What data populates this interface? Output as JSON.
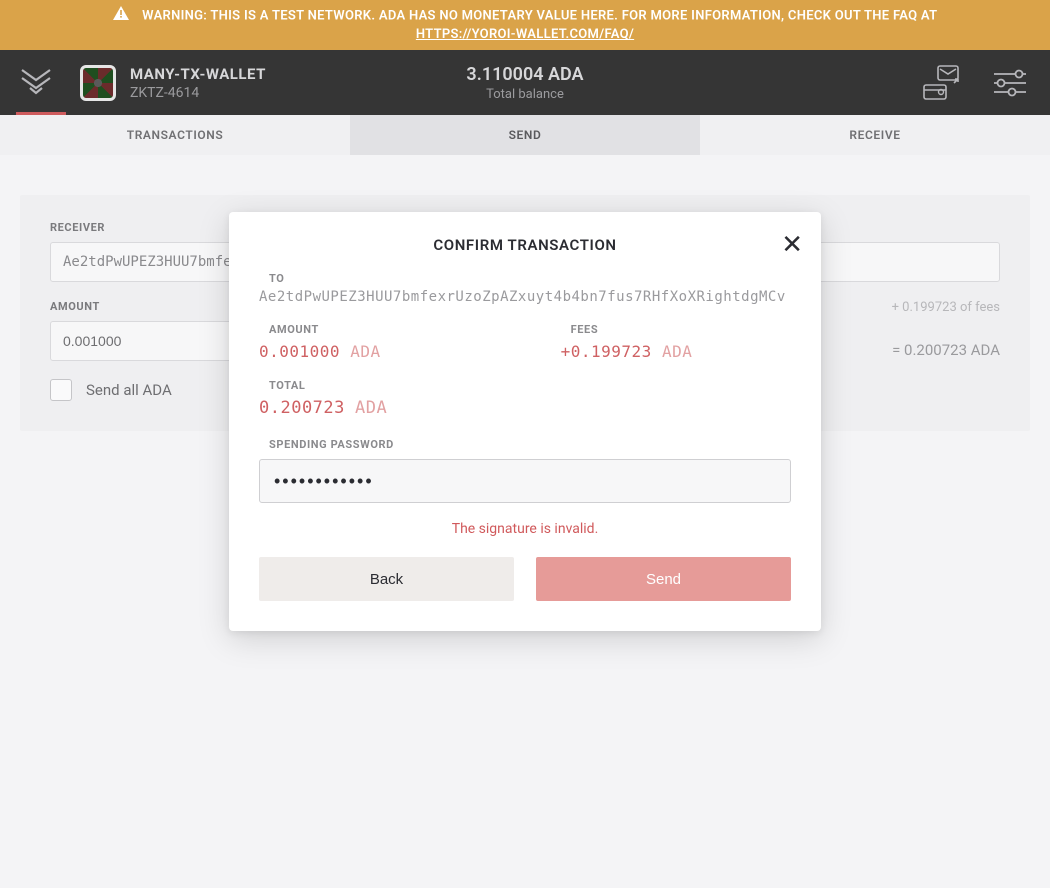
{
  "warning": {
    "prefix": "WARNING: THIS IS A TEST NETWORK. ADA HAS NO MONETARY VALUE HERE. FOR MORE INFORMATION, CHECK OUT THE FAQ AT",
    "link_text": "HTTPS://YOROI-WALLET.COM/FAQ/"
  },
  "header": {
    "wallet_name": "MANY-TX-WALLET",
    "wallet_sub": "ZKTZ-4614",
    "balance_amount": "3.110004 ADA",
    "balance_label": "Total balance"
  },
  "tabs": {
    "transactions": "TRANSACTIONS",
    "send": "SEND",
    "receive": "RECEIVE"
  },
  "send_form": {
    "receiver_label": "RECEIVER",
    "receiver_value": "Ae2tdPwUPEZ3HUU7bmfe",
    "amount_label": "AMOUNT",
    "amount_value": "0.001000",
    "fees_text": "+ 0.199723 of fees",
    "total_text": "= 0.200723 ADA",
    "send_all": "Send all ADA"
  },
  "modal": {
    "title": "CONFIRM TRANSACTION",
    "to_label": "TO",
    "to_value": "Ae2tdPwUPEZ3HUU7bmfexrUzoZpAZxuyt4b4bn7fus7RHfXoXRightdgMCv",
    "amount_label": "AMOUNT",
    "amount_num": "0.001000",
    "amount_cur": "ADA",
    "fees_label": "FEES",
    "fees_num": "+0.199723",
    "fees_cur": "ADA",
    "total_label": "TOTAL",
    "total_num": "0.200723",
    "total_cur": "ADA",
    "pwd_label": "SPENDING PASSWORD",
    "pwd_value": "••••••••••••",
    "error": "The signature is invalid.",
    "back": "Back",
    "send": "Send"
  },
  "colors": {
    "accent": "#cf6163",
    "warn_bg": "#d9a454",
    "header_bg": "#353535"
  }
}
